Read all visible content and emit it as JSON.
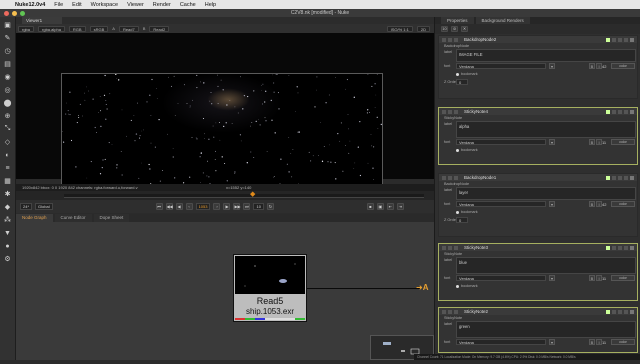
{
  "mac_menu": {
    "app": "Nuke12.0v4",
    "items": [
      "File",
      "Edit",
      "Workspace",
      "Viewer",
      "Render",
      "Cache",
      "Help"
    ]
  },
  "window": {
    "title": "C2V8.nk [modified] - Nuke"
  },
  "viewer": {
    "tab": "Viewer1",
    "controls": [
      "rgba",
      "rgba.alpha",
      "RGB",
      "sRGB",
      "A",
      "Read7",
      "B",
      "Read2"
    ],
    "zoom": "ISO/% 1:1",
    "proxy": "2D",
    "res_label": "1920x842",
    "info_left": "1920x842  bbox: 0 0 1920 842 channels: rgba.forward.u,forward.v",
    "info_xy": "x=1552 y=140"
  },
  "playback": {
    "fps": "24*",
    "mode": "Global",
    "frame": "1053",
    "step": "10"
  },
  "node_graph": {
    "tabs": [
      "Node Graph",
      "Curve Editor",
      "Dope Sheet"
    ],
    "read_node": {
      "name": "Read5",
      "file": "ship.1053.exr"
    },
    "arrow_label": "A"
  },
  "status": "Channel Count: 71  Localization Mode: On  Memory: 9.7 GB (4.6%)  CPU: 2.9%  Disk: 0.0 MB/s  Network: 0.0 MB/s",
  "properties": {
    "tabs": [
      "Properties",
      "Background Renders"
    ],
    "panels": [
      {
        "title": "BackdropNode2",
        "subtab": "BackdropNode",
        "label": "IMAGE FILE",
        "font": "Verdana",
        "size": "42",
        "bookmark": "bookmark",
        "zorder_label": "Z Order",
        "zorder": "0",
        "color_label": "color",
        "font_label": "font",
        "label_label": "label"
      },
      {
        "title": "StickyNote4",
        "subtab": "StickyNote",
        "label": "alpha",
        "font": "Verdana",
        "size": "11",
        "bookmark": "bookmark",
        "color_label": "color",
        "font_label": "font",
        "label_label": "label"
      },
      {
        "title": "BackdropNode1",
        "subtab": "BackdropNode",
        "label": "layer",
        "font": "Verdana",
        "size": "42",
        "bookmark": "bookmark",
        "zorder_label": "Z Order",
        "zorder": "0",
        "color_label": "color",
        "font_label": "font",
        "label_label": "label"
      },
      {
        "title": "StickyNote3",
        "subtab": "StickyNote",
        "label": "blue",
        "font": "Verdana",
        "size": "11",
        "bookmark": "bookmark",
        "color_label": "color",
        "font_label": "font",
        "label_label": "label"
      },
      {
        "title": "StickyNote2",
        "subtab": "StickyNote",
        "label": "green",
        "font": "Verdana",
        "size": "11",
        "color_label": "color",
        "font_label": "font",
        "label_label": "label"
      }
    ]
  },
  "colors": {
    "accent_orange": "#e08a1a",
    "sticky_border": "#a6b060",
    "node_body": "#bdbdbd"
  }
}
